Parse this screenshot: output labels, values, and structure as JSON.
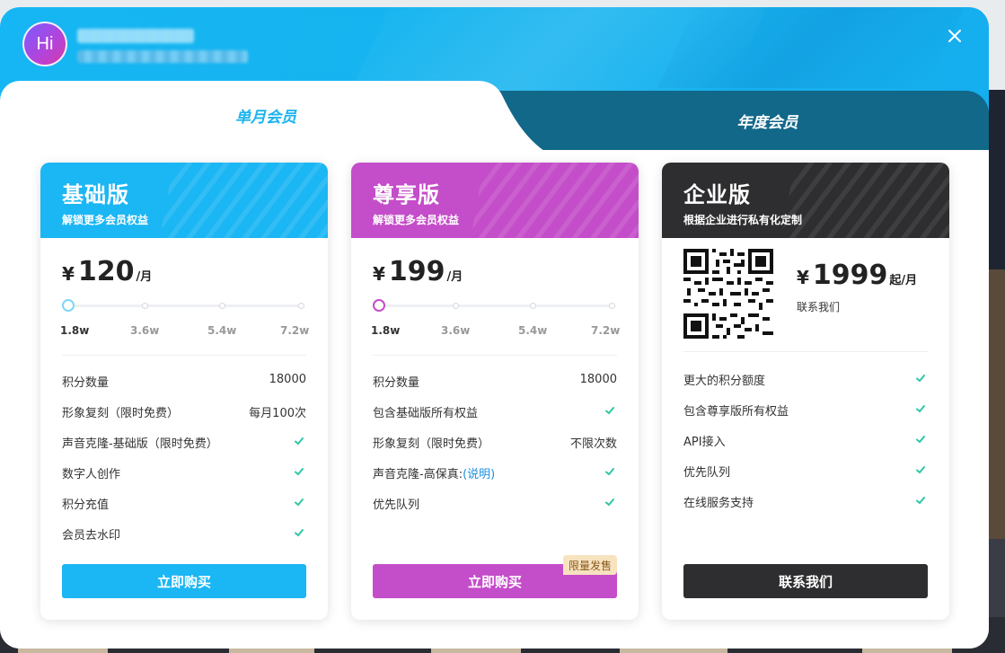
{
  "header": {
    "avatar_text": "Hi",
    "close_icon": "close-icon"
  },
  "tabs": [
    {
      "label": "单月会员",
      "active": true
    },
    {
      "label": "年度会员",
      "active": false
    }
  ],
  "colors": {
    "header_blue": "#15b6f3",
    "tab_dark": "#126889",
    "basic": "#1bb6f4",
    "premium": "#c44dc9",
    "enterprise": "#2e2e30",
    "check": "#2cc6a6"
  },
  "plans": {
    "basic": {
      "title": "基础版",
      "subtitle": "解锁更多会员权益",
      "currency": "¥",
      "price": "120",
      "unit": "/月",
      "ticks": [
        "1.8w",
        "3.6w",
        "5.4w",
        "7.2w"
      ],
      "selected_tick": 0,
      "features": [
        {
          "label": "积分数量",
          "value": "18000"
        },
        {
          "label": "形象复刻（限时免费）",
          "value": "每月100次"
        },
        {
          "label": "声音克隆-基础版（限时免费）",
          "value": "check"
        },
        {
          "label": "数字人创作",
          "value": "check"
        },
        {
          "label": "积分充值",
          "value": "check"
        },
        {
          "label": "会员去水印",
          "value": "check"
        }
      ],
      "button": "立即购买"
    },
    "premium": {
      "title": "尊享版",
      "subtitle": "解锁更多会员权益",
      "currency": "¥",
      "price": "199",
      "unit": "/月",
      "ticks": [
        "1.8w",
        "3.6w",
        "5.4w",
        "7.2w"
      ],
      "selected_tick": 0,
      "features": [
        {
          "label": "积分数量",
          "value": "18000"
        },
        {
          "label": "包含基础版所有权益",
          "value": "check"
        },
        {
          "label": "形象复刻（限时免费）",
          "value": "不限次数"
        },
        {
          "label": "声音克隆-高保真:",
          "link": "(说明)",
          "value": "check"
        },
        {
          "label": "优先队列",
          "value": "check"
        }
      ],
      "badge": "限量发售",
      "button": "立即购买"
    },
    "enterprise": {
      "title": "企业版",
      "subtitle": "根据企业进行私有化定制",
      "currency": "¥",
      "price": "1999",
      "unit": "起/月",
      "contact": "联系我们",
      "features": [
        {
          "label": "更大的积分额度",
          "value": "check"
        },
        {
          "label": "包含尊享版所有权益",
          "value": "check"
        },
        {
          "label": "API接入",
          "value": "check"
        },
        {
          "label": "优先队列",
          "value": "check"
        },
        {
          "label": "在线服务支持",
          "value": "check"
        }
      ],
      "button": "联系我们"
    }
  }
}
